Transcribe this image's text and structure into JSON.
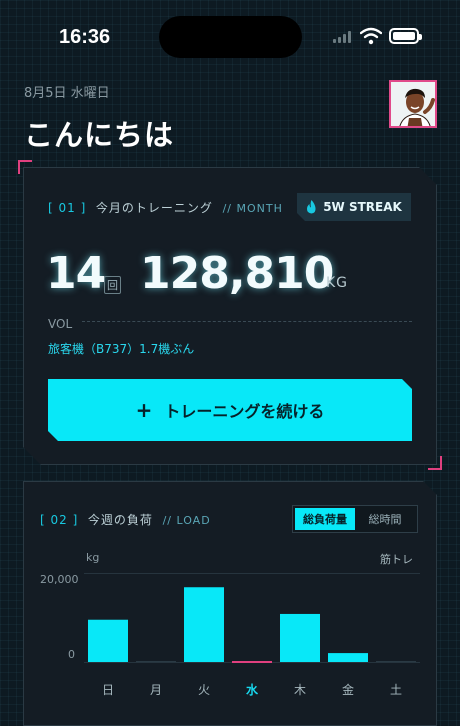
{
  "status": {
    "time": "16:36"
  },
  "header": {
    "date": "8月5日 水曜日",
    "greeting": "こんにちは"
  },
  "month_card": {
    "label_index": "[ 01 ]",
    "label": "今月のトレーニング",
    "label_sub": "// MONTH",
    "streak": "5W STREAK",
    "sessions": "14",
    "sessions_unit": "回",
    "volume": "128,810",
    "volume_unit": "KG",
    "vol_label": "VOL",
    "equivalent": "旅客機（B737）1.7機ぶん",
    "cta_plus": "+",
    "cta_label": "トレーニングを続ける"
  },
  "load_card": {
    "label_index": "[ 02 ]",
    "label": "今週の負荷",
    "label_sub": "// LOAD",
    "toggle": [
      "総負荷量",
      "総時間"
    ],
    "unit": "kg",
    "category": "筋トレ",
    "y_top": "20,000",
    "y_bottom": "0"
  },
  "chart_data": {
    "type": "bar",
    "categories": [
      "日",
      "月",
      "火",
      "水",
      "木",
      "金",
      "土"
    ],
    "values": [
      9500,
      0,
      16800,
      0,
      10800,
      2000,
      0
    ],
    "ylabel": "kg",
    "ylim": [
      0,
      20000
    ],
    "highlight_category": "水",
    "bar_color": "#08e8f8",
    "today_color": "#e0407f"
  },
  "colors": {
    "accent": "#08e8f8",
    "pink": "#e0407f",
    "bg": "#0d1a22"
  }
}
